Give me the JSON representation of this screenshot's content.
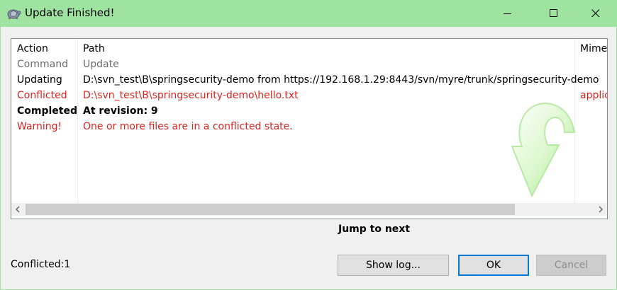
{
  "window": {
    "title": "Update Finished!",
    "buttons": [
      "minimize",
      "maximize",
      "close"
    ]
  },
  "list": {
    "columns": [
      "Action",
      "Path",
      "Mime"
    ],
    "rows": [
      {
        "action": "Command",
        "path": "Update",
        "mime": "",
        "style": "gray"
      },
      {
        "action": "Updating",
        "path": "D:\\svn_test\\B\\springsecurity-demo from https://192.168.1.29:8443/svn/myre/trunk/springsecurity-demo",
        "mime": "",
        "style": "normal"
      },
      {
        "action": "Conflicted",
        "path": "D:\\svn_test\\B\\springsecurity-demo\\hello.txt",
        "mime": "applic",
        "style": "red"
      },
      {
        "action": "Completed",
        "path": "At revision: 9",
        "mime": "",
        "style": "bold"
      },
      {
        "action": "Warning!",
        "path": "One or more files are in a conflicted state.",
        "mime": "",
        "style": "red"
      }
    ]
  },
  "jump_label": "Jump to next",
  "status": "Conflicted:1",
  "buttons": {
    "show_log": "Show log...",
    "ok": "OK",
    "cancel": "Cancel"
  },
  "colors": {
    "titlebar": "#9fe3a0",
    "conflict_red": "#e0221e",
    "ok_focus": "#0078d7"
  },
  "icons": [
    "app-turtle-icon",
    "minimize-icon",
    "maximize-icon",
    "close-icon",
    "update-arrow-icon",
    "scroll-left-icon",
    "scroll-right-icon"
  ]
}
